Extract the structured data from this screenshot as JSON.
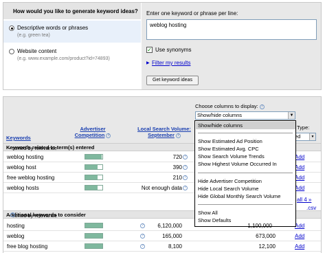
{
  "generate": {
    "question": "How would you like to generate keyword ideas?",
    "option1_label": "Descriptive words or phrases",
    "option1_hint": "(e.g. green tea)",
    "option2_label": "Website content",
    "option2_hint": "(e.g. www.example.com/product?id=74893)"
  },
  "entry": {
    "prompt": "Enter one keyword or phrase per line:",
    "value": "weblog hosting",
    "synonyms_label": "Use synonyms",
    "filter_link": "Filter my results",
    "button": "Get keyword ideas"
  },
  "columns_chooser": {
    "label": "Choose columns to display:",
    "selected": "Show/hide columns",
    "options": [
      "Show/hide columns",
      "Show Estimated Ad Position",
      "Show Estimated Avg. CPC",
      "Show Search Volume Trends",
      "Show Highest Volume Occurred In",
      "Hide Advertiser Competition",
      "Hide Local Search Volume",
      "Hide Global Monthly Search Volume",
      "Show All",
      "Show Defaults"
    ]
  },
  "match": {
    "label": "Type:",
    "value": "ed"
  },
  "table_headers": {
    "keywords": "Keywords",
    "competition": "Advertiser Competition",
    "local_volume": "Local Search Volume: September"
  },
  "section1": {
    "title": "Keywords related to term(s) entered",
    "sort": " - sorted by relevance",
    "rows": [
      {
        "keyword": "weblog hosting",
        "competition": 0.95,
        "volume": "720",
        "add": "Add"
      },
      {
        "keyword": "weblog host",
        "competition": 0.7,
        "volume": "390",
        "add": "Add"
      },
      {
        "keyword": "free weblog hosting",
        "competition": 0.7,
        "volume": "210",
        "add": "Add"
      },
      {
        "keyword": "weblog hosts",
        "competition": 0.7,
        "volume": "Not enough data",
        "add": "Add"
      }
    ]
  },
  "pagination": {
    "text": "all 4 »",
    "csv": ".csv"
  },
  "section2": {
    "title": "Additional keywords to consider",
    "sort": " - sorted by relevance",
    "rows": [
      {
        "keyword": "hosting",
        "competition": 1.0,
        "volume": "6,120,000",
        "global": "",
        "add": "Add"
      },
      {
        "keyword": "weblog",
        "competition": 1.0,
        "volume": "165,000",
        "global": "673,000",
        "add": "Add"
      },
      {
        "keyword": "free blog hosting",
        "competition": 1.0,
        "volume": "8,100",
        "global": "12,100",
        "add": "Add"
      }
    ],
    "partial_global": "1,100,000"
  },
  "colors": {
    "bar_fill": "#7fb89e",
    "link": "#0000cc",
    "header_link": "#1a3fb0"
  }
}
